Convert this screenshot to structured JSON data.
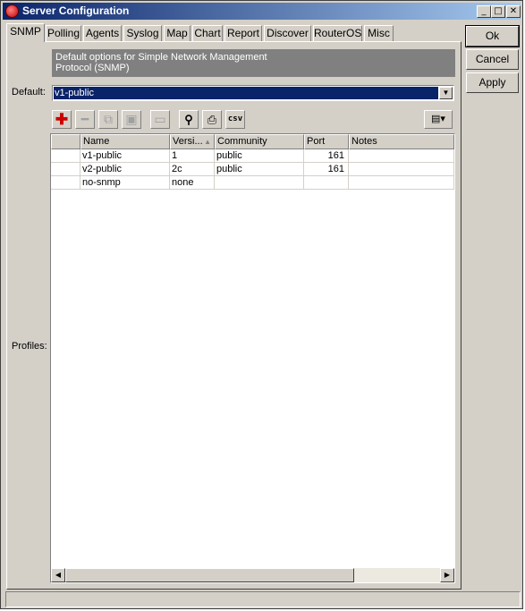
{
  "window": {
    "title": "Server Configuration"
  },
  "tabs": [
    "SNMP",
    "Polling",
    "Agents",
    "Syslog",
    "Map",
    "Chart",
    "Report",
    "Discover",
    "RouterOS",
    "Misc"
  ],
  "active_tab": "SNMP",
  "banner": {
    "line1": "Default options for Simple Network Management",
    "line2": "Protocol (SNMP)"
  },
  "default_field": {
    "label": "Default:",
    "value": "v1-public"
  },
  "profiles_label": "Profiles:",
  "toolbar": {
    "csv_label": "csv"
  },
  "table": {
    "columns": [
      "",
      "Name",
      "Versi...",
      "Community",
      "Port",
      "Notes"
    ],
    "rows": [
      {
        "name": "v1-public",
        "version": "1",
        "community": "public",
        "port": "161",
        "notes": ""
      },
      {
        "name": "v2-public",
        "version": "2c",
        "community": "public",
        "port": "161",
        "notes": ""
      },
      {
        "name": "no-snmp",
        "version": "none",
        "community": "",
        "port": "",
        "notes": ""
      }
    ]
  },
  "buttons": {
    "ok": "Ok",
    "cancel": "Cancel",
    "apply": "Apply"
  },
  "colors": {
    "selection": "#0a246a",
    "banner": "#808080",
    "add_icon": "#cc0000"
  }
}
